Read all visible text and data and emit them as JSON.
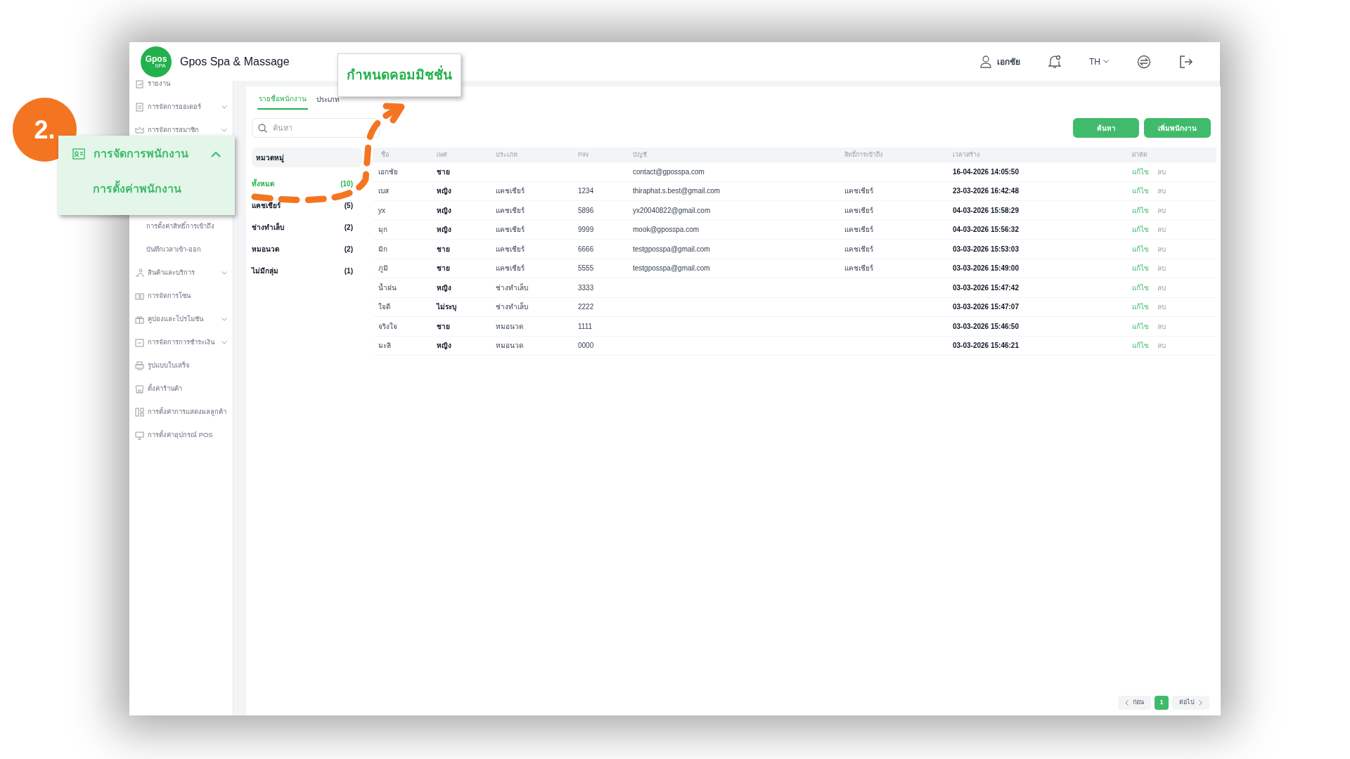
{
  "header": {
    "app_title": "Gpos Spa & Massage",
    "logo_text": "Gpos",
    "logo_sub": "SPA",
    "user": "เอกชัย",
    "language": "TH"
  },
  "sidebar": {
    "items": [
      {
        "label": "รายงาน",
        "kind": "item",
        "expandable": false
      },
      {
        "label": "การจัดการออเดอร์",
        "kind": "item",
        "expandable": true
      },
      {
        "label": "การจัดการสมาชิก",
        "kind": "item",
        "expandable": true
      },
      {
        "label": "การตั้งค่าสิทธิ์การเข้าถึง",
        "kind": "sub",
        "expandable": false
      },
      {
        "label": "บันทึกเวลาเข้า-ออก",
        "kind": "sub",
        "expandable": false
      },
      {
        "label": "สินค้าและบริการ",
        "kind": "item",
        "expandable": true
      },
      {
        "label": "การจัดการโซน",
        "kind": "item",
        "expandable": false
      },
      {
        "label": "คูปองและโปรโมชัน",
        "kind": "item",
        "expandable": true
      },
      {
        "label": "การจัดการการชำระเงิน",
        "kind": "item",
        "expandable": true
      },
      {
        "label": "รูปแบบใบเสร็จ",
        "kind": "item",
        "expandable": false
      },
      {
        "label": "ตั้งค่าร้านค้า",
        "kind": "item",
        "expandable": false
      },
      {
        "label": "การตั้งค่าการแสดงผลลูกค้า",
        "kind": "item",
        "expandable": false
      },
      {
        "label": "การตั้งค่าอุปกรณ์ POS",
        "kind": "item",
        "expandable": false
      }
    ]
  },
  "tabs": [
    {
      "label": "รายชื่อพนักงาน",
      "selected": true
    },
    {
      "label": "ประเภท",
      "selected": false
    }
  ],
  "search": {
    "placeholder": "ค้นหา"
  },
  "buttons": {
    "search": "ค้นหา",
    "add": "เพิ่มพนักงาน"
  },
  "categories": {
    "title": "หมวดหมู่",
    "items": [
      {
        "label": "ทั้งหมด",
        "count": "(10)",
        "selected": true
      },
      {
        "label": "แคชเชียร์",
        "count": "(5)",
        "selected": false
      },
      {
        "label": "ช่างทำเล็บ",
        "count": "(2)",
        "selected": false
      },
      {
        "label": "หมอนวด",
        "count": "(2)",
        "selected": false
      },
      {
        "label": "ไม่มีกลุ่ม",
        "count": "(1)",
        "selected": false
      }
    ]
  },
  "table": {
    "columns": [
      "ชื่อ",
      "เพศ",
      "ประเภท",
      "PIN",
      "บัญชี",
      "สิทธิ์การเข้าถึง",
      "เวลาสร้าง",
      "ผ่าตัด"
    ],
    "rows": [
      {
        "name": "เอกชัย",
        "gender": "ชาย",
        "type": "",
        "pin": "",
        "account": "contact@gposspa.com",
        "access": "",
        "created": "16-04-2026 14:05:50",
        "edit": "แก้ไข",
        "delete": "ลบ"
      },
      {
        "name": "เบส",
        "gender": "หญิง",
        "type": "แคชเชียร์",
        "pin": "1234",
        "account": "thiraphat.s.best@gmail.com",
        "access": "แคชเชียร์",
        "created": "23-03-2026 16:42:48",
        "edit": "แก้ไข",
        "delete": "ลบ"
      },
      {
        "name": "yx",
        "gender": "หญิง",
        "type": "แคชเชียร์",
        "pin": "5896",
        "account": "yx20040822@gmail.com",
        "access": "แคชเชียร์",
        "created": "04-03-2026 15:58:29",
        "edit": "แก้ไข",
        "delete": "ลบ"
      },
      {
        "name": "มุก",
        "gender": "หญิง",
        "type": "แคชเชียร์",
        "pin": "9999",
        "account": "mook@gposspa.com",
        "access": "แคชเชียร์",
        "created": "04-03-2026 15:56:32",
        "edit": "แก้ไข",
        "delete": "ลบ"
      },
      {
        "name": "มิก",
        "gender": "ชาย",
        "type": "แคชเชียร์",
        "pin": "6666",
        "account": "testgposspa@gmail.com",
        "access": "แคชเชียร์",
        "created": "03-03-2026 15:53:03",
        "edit": "แก้ไข",
        "delete": "ลบ"
      },
      {
        "name": "ภูมิ",
        "gender": "ชาย",
        "type": "แคชเชียร์",
        "pin": "5555",
        "account": "testgposspa@gmail.com",
        "access": "แคชเชียร์",
        "created": "03-03-2026 15:49:00",
        "edit": "แก้ไข",
        "delete": "ลบ"
      },
      {
        "name": "น้ำฝน",
        "gender": "หญิง",
        "type": "ช่างทำเล็บ",
        "pin": "3333",
        "account": "",
        "access": "",
        "created": "03-03-2026 15:47:42",
        "edit": "แก้ไข",
        "delete": "ลบ"
      },
      {
        "name": "ใจดี",
        "gender": "ไม่ระบุ",
        "type": "ช่างทำเล็บ",
        "pin": "2222",
        "account": "",
        "access": "",
        "created": "03-03-2026 15:47:07",
        "edit": "แก้ไข",
        "delete": "ลบ"
      },
      {
        "name": "จริงใจ",
        "gender": "ชาย",
        "type": "หมอนวด",
        "pin": "1111",
        "account": "",
        "access": "",
        "created": "03-03-2026 15:46:50",
        "edit": "แก้ไข",
        "delete": "ลบ"
      },
      {
        "name": "มะลิ",
        "gender": "หญิง",
        "type": "หมอนวด",
        "pin": "0000",
        "account": "",
        "access": "",
        "created": "03-03-2026 15:46:21",
        "edit": "แก้ไข",
        "delete": "ลบ"
      }
    ]
  },
  "pagination": {
    "prev": "ก่อน",
    "pages": [
      {
        "label": "1",
        "selected": true
      }
    ],
    "next": "ต่อไป"
  },
  "annotations": {
    "step": "2.",
    "menu_callout": {
      "title": "การจัดการพนักงาน",
      "expanded": true,
      "sub_item": "การตั้งค่าพนักงาน"
    },
    "target_callout": "กำหนดคอมมิชชั่น"
  }
}
